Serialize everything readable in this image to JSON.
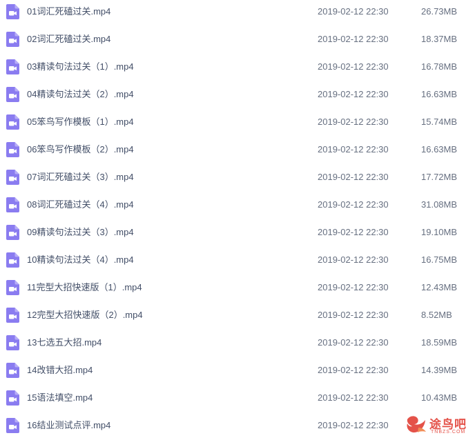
{
  "files": [
    {
      "name": "01词汇死磕过关.mp4",
      "date": "2019-02-12 22:30",
      "size": "26.73MB",
      "icon": "video-file-icon"
    },
    {
      "name": "02词汇死磕过关.mp4",
      "date": "2019-02-12 22:30",
      "size": "18.37MB",
      "icon": "video-file-icon"
    },
    {
      "name": "03精读句法过关（1）.mp4",
      "date": "2019-02-12 22:30",
      "size": "16.78MB",
      "icon": "video-file-icon"
    },
    {
      "name": "04精读句法过关（2）.mp4",
      "date": "2019-02-12 22:30",
      "size": "16.63MB",
      "icon": "video-file-icon"
    },
    {
      "name": "05笨鸟写作模板（1）.mp4",
      "date": "2019-02-12 22:30",
      "size": "15.74MB",
      "icon": "video-file-icon"
    },
    {
      "name": "06笨鸟写作模板（2）.mp4",
      "date": "2019-02-12 22:30",
      "size": "16.63MB",
      "icon": "video-file-icon"
    },
    {
      "name": "07词汇死磕过关（3）.mp4",
      "date": "2019-02-12 22:30",
      "size": "17.72MB",
      "icon": "video-file-icon"
    },
    {
      "name": "08词汇死磕过关（4）.mp4",
      "date": "2019-02-12 22:30",
      "size": "31.08MB",
      "icon": "video-file-icon"
    },
    {
      "name": "09精读句法过关（3）.mp4",
      "date": "2019-02-12 22:30",
      "size": "19.10MB",
      "icon": "video-file-icon"
    },
    {
      "name": "10精读句法过关（4）.mp4",
      "date": "2019-02-12 22:30",
      "size": "16.75MB",
      "icon": "video-file-icon"
    },
    {
      "name": "11完型大招快速版（1）.mp4",
      "date": "2019-02-12 22:30",
      "size": "12.43MB",
      "icon": "video-file-icon"
    },
    {
      "name": "12完型大招快速版（2）.mp4",
      "date": "2019-02-12 22:30",
      "size": "8.52MB",
      "icon": "video-file-icon"
    },
    {
      "name": "13七选五大招.mp4",
      "date": "2019-02-12 22:30",
      "size": "18.59MB",
      "icon": "video-file-icon"
    },
    {
      "name": "14改错大招.mp4",
      "date": "2019-02-12 22:30",
      "size": "14.39MB",
      "icon": "video-file-icon"
    },
    {
      "name": "15语法填空.mp4",
      "date": "2019-02-12 22:30",
      "size": "10.43MB",
      "icon": "video-file-icon"
    },
    {
      "name": "16结业测试点评.mp4",
      "date": "2019-02-12 22:30",
      "size": "",
      "icon": "video-file-icon"
    }
  ],
  "watermark": {
    "title": "途鸟吧",
    "subtitle": "TNBZS.COM",
    "color": "#e0342a"
  },
  "colors": {
    "icon_fill": "#8a7cf0",
    "text": "#424e67",
    "meta_text": "#666f80"
  }
}
